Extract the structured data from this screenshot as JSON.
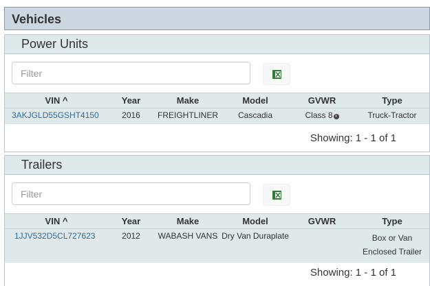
{
  "page": {
    "title": "Vehicles"
  },
  "excel_icon": "excel-export-icon",
  "columns": [
    "VIN",
    "Year",
    "Make",
    "Model",
    "GVWR",
    "Type"
  ],
  "sort_indicator": "^",
  "power_units": {
    "title": "Power Units",
    "filter_placeholder": "Filter",
    "rows": [
      {
        "vin": "3AKJGLD55GSHT4150",
        "year": "2016",
        "make": "FREIGHTLINER",
        "model": "Cascadia",
        "gvwr": "Class 8",
        "type": "Truck-Tractor"
      }
    ],
    "showing": "Showing: 1 - 1 of 1"
  },
  "trailers": {
    "title": "Trailers",
    "filter_placeholder": "Filter",
    "rows": [
      {
        "vin": "1JJV532D5CL727623",
        "year": "2012",
        "make": "WABASH VANS",
        "model": "Dry Van Duraplate",
        "gvwr": "",
        "type_line1": "Box or Van",
        "type_line2": "Enclosed Trailer"
      }
    ],
    "showing": "Showing: 1 - 1 of 1"
  }
}
